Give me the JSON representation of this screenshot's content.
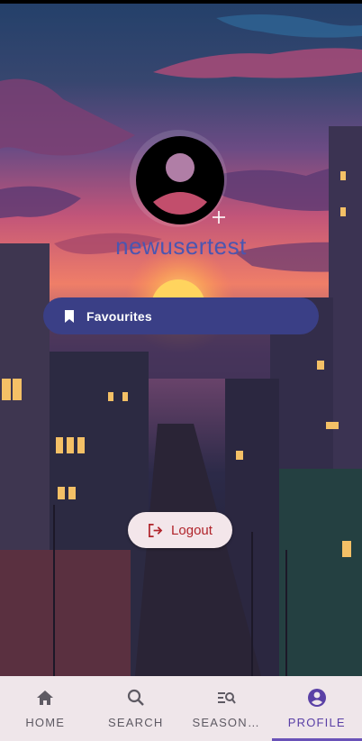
{
  "profile": {
    "username": "newusertest"
  },
  "favourites_button": {
    "label": "Favourites",
    "icon": "bookmark-icon"
  },
  "logout_button": {
    "label": "Logout",
    "icon": "logout-icon"
  },
  "bottom_nav": {
    "items": [
      {
        "label": "HOME",
        "icon": "home-icon",
        "active": false
      },
      {
        "label": "SEARCH",
        "icon": "search-icon",
        "active": false
      },
      {
        "label": "SEASON…",
        "icon": "season-search-icon",
        "active": false
      },
      {
        "label": "PROFILE",
        "icon": "account-circle-icon",
        "active": true
      }
    ]
  },
  "colors": {
    "accent": "#3a3f86",
    "username": "#4b56b0",
    "logout_text": "#b0232a",
    "nav_active": "#5a40a6",
    "nav_bg": "#efe6ea"
  }
}
